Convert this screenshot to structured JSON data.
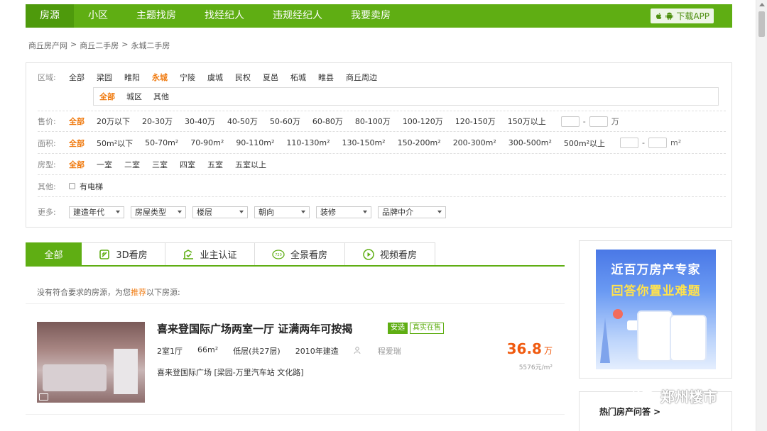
{
  "nav": {
    "items": [
      "房源",
      "小区",
      "主题找房",
      "找经纪人",
      "违规经纪人",
      "我要卖房"
    ],
    "active_index": 0,
    "download_label": "下载APP"
  },
  "breadcrumb": [
    "商丘房产网",
    ">",
    "商丘二手房",
    ">",
    "永城二手房"
  ],
  "filters": {
    "region": {
      "label": "区域:",
      "options": [
        "全部",
        "梁园",
        "睢阳",
        "永城",
        "宁陵",
        "虞城",
        "民权",
        "夏邑",
        "柘城",
        "睢县",
        "商丘周边"
      ],
      "active_index": 3,
      "sub_options": [
        "全部",
        "城区",
        "其他"
      ],
      "sub_active_index": 0
    },
    "price": {
      "label": "售价:",
      "options": [
        "全部",
        "20万以下",
        "20-30万",
        "30-40万",
        "40-50万",
        "50-60万",
        "60-80万",
        "80-100万",
        "100-120万",
        "120-150万",
        "150万以上"
      ],
      "active_index": 0,
      "range_separator": "-",
      "range_unit": "万"
    },
    "area": {
      "label": "面积:",
      "options": [
        "全部",
        "50m²以下",
        "50-70m²",
        "70-90m²",
        "90-110m²",
        "110-130m²",
        "130-150m²",
        "150-200m²",
        "200-300m²",
        "300-500m²",
        "500m²以上"
      ],
      "active_index": 0,
      "range_separator": "-",
      "range_unit": "m²"
    },
    "layout": {
      "label": "房型:",
      "options": [
        "全部",
        "一室",
        "二室",
        "三室",
        "四室",
        "五室",
        "五室以上"
      ],
      "active_index": 0
    },
    "other": {
      "label": "其他:",
      "checkbox_label": "有电梯"
    },
    "more": {
      "label": "更多:",
      "selects": [
        "建造年代",
        "房屋类型",
        "楼层",
        "朝向",
        "装修",
        "品牌中介"
      ]
    }
  },
  "tabs": [
    "全部",
    "3D看房",
    "业主认证",
    "全景看房",
    "视频看房"
  ],
  "no_result": {
    "prefix": "没有符合要求的房源，为您",
    "highlight": "推荐",
    "suffix": "以下房源:"
  },
  "listing": {
    "title": "喜来登国际广场两室一厅 证满两年可按揭",
    "tag1": "安选",
    "tag2": "真实在售",
    "rooms": "2室1厅",
    "area": "66m²",
    "floor": "低层(共27层)",
    "built": "2010年建造",
    "agent": "程爱瑞",
    "address": "喜来登国际广场  [梁园-万里汽车站 文化路]",
    "price": "36.8",
    "price_unit": "万",
    "unit_price": "5576元/m²"
  },
  "sidebar": {
    "ad_line1": "近百万房产专家",
    "ad_line2": "回答你置业难题",
    "hot_qa": "热门房产问答 >"
  },
  "watermark": "郑州楼市",
  "colors": {
    "brand_green": "#5fae13",
    "highlight_orange": "#f07a0f",
    "price_red": "#f05a0f"
  }
}
